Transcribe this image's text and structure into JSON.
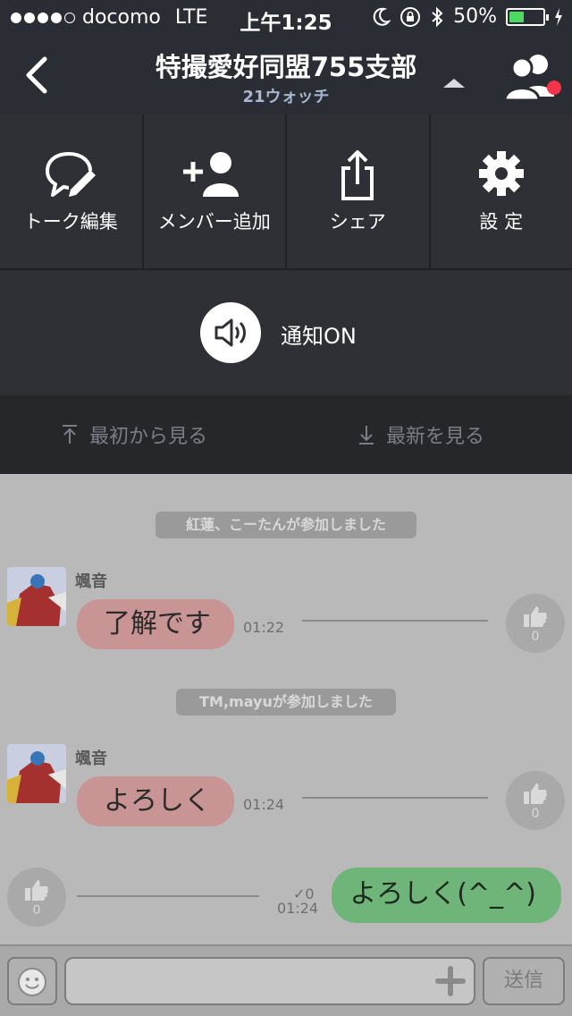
{
  "status_bar": {
    "carrier": "docomo",
    "network": "LTE",
    "time": "上午1:25",
    "battery": "50%",
    "battery_level": 0.5
  },
  "header": {
    "title": "特撮愛好同盟755支部",
    "subtitle": "21ウォッチ"
  },
  "menu": {
    "items": [
      {
        "label": "トーク編集",
        "icon": "chat-edit-icon"
      },
      {
        "label": "メンバー追加",
        "icon": "add-member-icon"
      },
      {
        "label": "シェア",
        "icon": "share-icon"
      },
      {
        "label": "設 定",
        "icon": "gear-icon"
      }
    ],
    "notify_label": "通知ON"
  },
  "nav": {
    "first_label": "最初から見る",
    "latest_label": "最新を見る"
  },
  "chat": {
    "system_messages": [
      "紅蓮、こーたんが参加しました",
      "TM,mayuが参加しました"
    ],
    "messages": [
      {
        "sender": "颯音",
        "text": "了解です",
        "time": "01:22",
        "likes": "0"
      },
      {
        "sender": "颯音",
        "text": "よろしく",
        "time": "01:24",
        "likes": "0"
      }
    ],
    "outgoing": {
      "text": "よろしく(^_^)",
      "time": "01:24",
      "read": "0",
      "likes": "0"
    }
  },
  "input": {
    "placeholder": "",
    "send_label": "送信"
  },
  "colors": {
    "header_bg": "#2a2d33",
    "incoming_bubble": "#c99494",
    "outgoing_bubble": "#6fb57a",
    "notification_dot": "#f3344a"
  }
}
